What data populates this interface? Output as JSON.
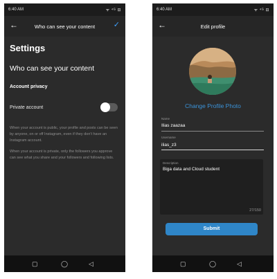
{
  "status_left": {
    "time": "6:40 AM",
    "icons": "ᯤ ⁴ᴳ ⊟"
  },
  "status_right": {
    "time": "6:40 AM",
    "icons": "ᯤ ⁴ᴳ ⊟"
  },
  "privacy_screen": {
    "title": "Who can see your content",
    "settings_heading": "Settings",
    "section_heading": "Who can see your content",
    "subheading": "Account privacy",
    "private_account_label": "Private account",
    "private_account_enabled": false,
    "description_public": "When your account is public, your profile and posts can be seen by anyone, on or off Instagram, even if they don't have an Instagram account.",
    "description_private": "When your account is private, only the followers you approve can see what you share and your followers and following lists."
  },
  "edit_profile_screen": {
    "title": "Edit profile",
    "change_photo_label": "Change Profile Photo",
    "name_label": "Name",
    "name_value": "Ilias zaazaa",
    "username_label": "Username",
    "username_value": "ilias_z3",
    "bio_label": "Description",
    "bio_value": "Biga data and Cloud student",
    "bio_counter": "27/150",
    "submit_label": "Submit"
  },
  "colors": {
    "accent": "#3fa2ff",
    "button": "#2f86c8",
    "background": "#2b2b2b"
  },
  "icons": {
    "back": "arrow-left-icon",
    "confirm": "check-icon",
    "nav_recent": "square-icon",
    "nav_home": "circle-icon",
    "nav_back": "triangle-back-icon"
  }
}
